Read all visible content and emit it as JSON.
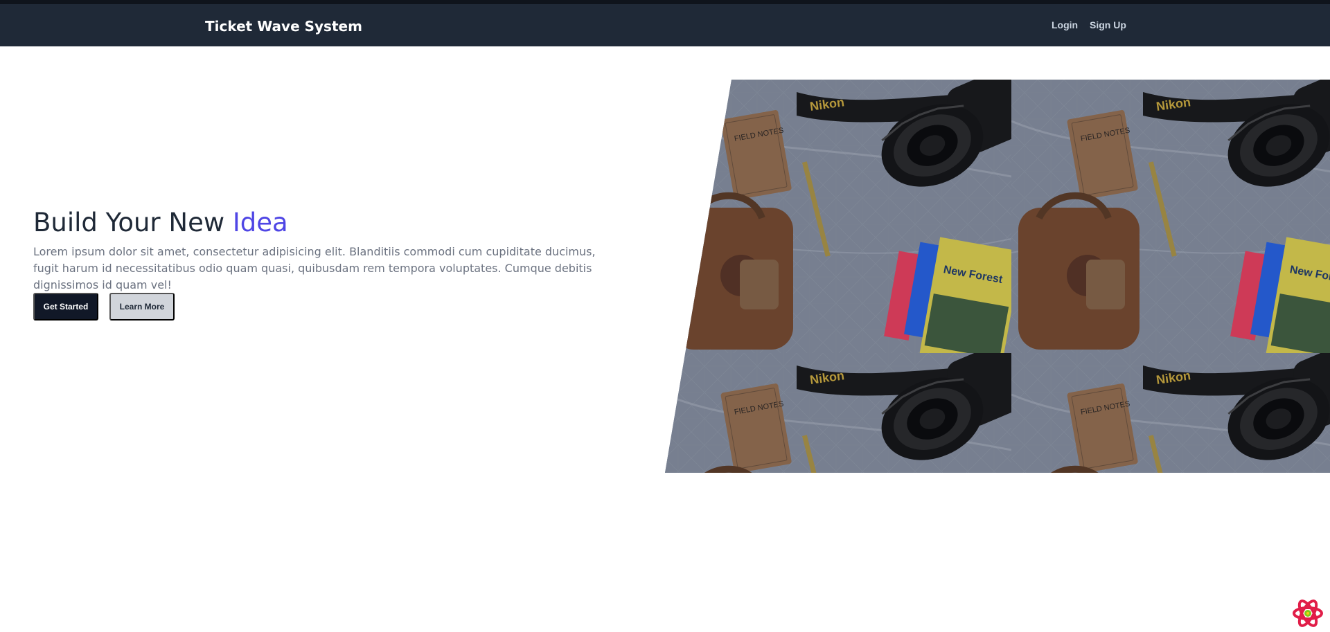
{
  "app": {
    "brand": "Ticket Wave System"
  },
  "nav": {
    "login": "Login",
    "signup": "Sign Up"
  },
  "hero": {
    "title_main": "Build Your New ",
    "title_accent": "Idea",
    "description": "Lorem ipsum dolor sit amet, consectetur adipisicing elit. Blanditiis commodi cum cupiditate ducimus, fugit harum id necessitatibus odio quam quasi, quibusdam rem tempora voluptates. Cumque debitis dignissimos id quam vel!",
    "get_started": "Get Started",
    "learn_more": "Learn More"
  },
  "image": {
    "items": [
      "FIELD NOTES",
      "Nikon",
      "New Forest"
    ]
  },
  "colors": {
    "nav_bg": "#1f2937",
    "accent": "#4f46e5",
    "primary_button": "#111827",
    "secondary_button": "#d1d5db"
  },
  "icons": {
    "dev_tools": "react-icon"
  }
}
